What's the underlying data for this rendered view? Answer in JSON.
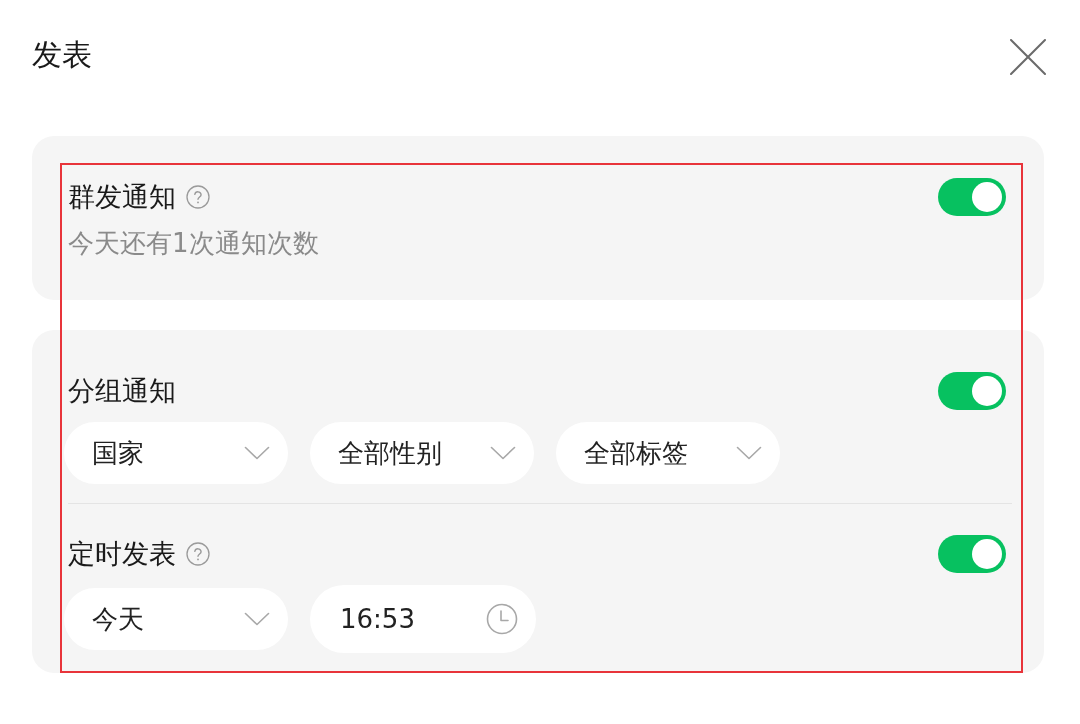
{
  "dialog": {
    "title": "发表"
  },
  "highlight_outline": true,
  "cards": [
    {
      "settings": [
        {
          "label": "群发通知",
          "help": true,
          "on": true,
          "note": "今天还有1次通知次数"
        }
      ]
    },
    {
      "settings": [
        {
          "label": "分组通知",
          "help": false,
          "on": true,
          "controls": [
            {
              "kind": "dropdown",
              "value": "国家"
            },
            {
              "kind": "dropdown",
              "value": "全部性别"
            },
            {
              "kind": "dropdown",
              "value": "全部标签"
            }
          ]
        },
        {
          "label": "定时发表",
          "help": true,
          "on": true,
          "controls": [
            {
              "kind": "dropdown",
              "value": "今天"
            },
            {
              "kind": "time",
              "value": "16:53"
            }
          ]
        }
      ]
    }
  ]
}
